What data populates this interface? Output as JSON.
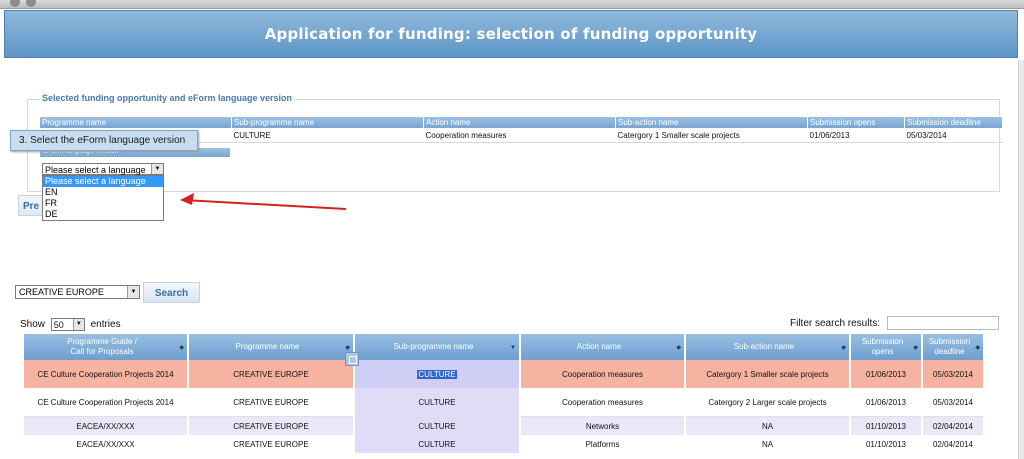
{
  "header": {
    "title": "Application for funding: selection of funding opportunity"
  },
  "selected_panel": {
    "legend": "Selected funding opportunity and eForm language version",
    "columns": [
      "Programme name",
      "Sub-programme name",
      "Action name",
      "Sub-action name",
      "Submission opens",
      "Submission deadline"
    ],
    "row": [
      "",
      "CULTURE",
      "Cooperation measures",
      "Catergory 1 Smaller scale projects",
      "01/06/2013",
      "05/03/2014"
    ],
    "language_label": "eForm language version"
  },
  "tooltip": "3. Select the eForm language version",
  "language_select": {
    "value": "Please select a language",
    "options": [
      "Please select a language",
      "EN",
      "FR",
      "DE"
    ]
  },
  "prev_button": "Pre",
  "search": {
    "programme_value": "CREATIVE EUROPE",
    "button": "Search"
  },
  "show": {
    "prefix": "Show",
    "value": "50",
    "suffix": "entries"
  },
  "filter": {
    "label": "Filter search results:"
  },
  "results": {
    "columns": [
      [
        "Programme Guide /",
        "Call for Proposals"
      ],
      [
        "Programme name"
      ],
      [
        "Sub-programme name"
      ],
      [
        "Action name"
      ],
      [
        "Sub-action name"
      ],
      [
        "Submission",
        "opens"
      ],
      [
        "Submission",
        "deadline"
      ]
    ],
    "rows": [
      [
        "CE Culture Cooperation Projects 2014",
        "CREATIVE EUROPE",
        "CULTURE",
        "Cooperation measures",
        "Catergory 1 Smaller scale projects",
        "01/06/2013",
        "05/03/2014"
      ],
      [
        "CE Culture Cooperation Projects 2014",
        "CREATIVE EUROPE",
        "CULTURE",
        "Cooperation measures",
        "Catergory 2 Larger scale projects",
        "01/06/2013",
        "05/03/2014"
      ],
      [
        "EACEA/XX/XXX",
        "CREATIVE EUROPE",
        "CULTURE",
        "Networks",
        "NA",
        "01/10/2013",
        "02/04/2014"
      ],
      [
        "EACEA/XX/XXX",
        "CREATIVE EUROPE",
        "CULTURE",
        "Platforms",
        "NA",
        "01/10/2013",
        "02/04/2014"
      ]
    ]
  },
  "colors": {
    "header_blue": "#5e95c6",
    "highlight_row": "#f6b3a1",
    "arrow_red": "#d61f1f"
  }
}
